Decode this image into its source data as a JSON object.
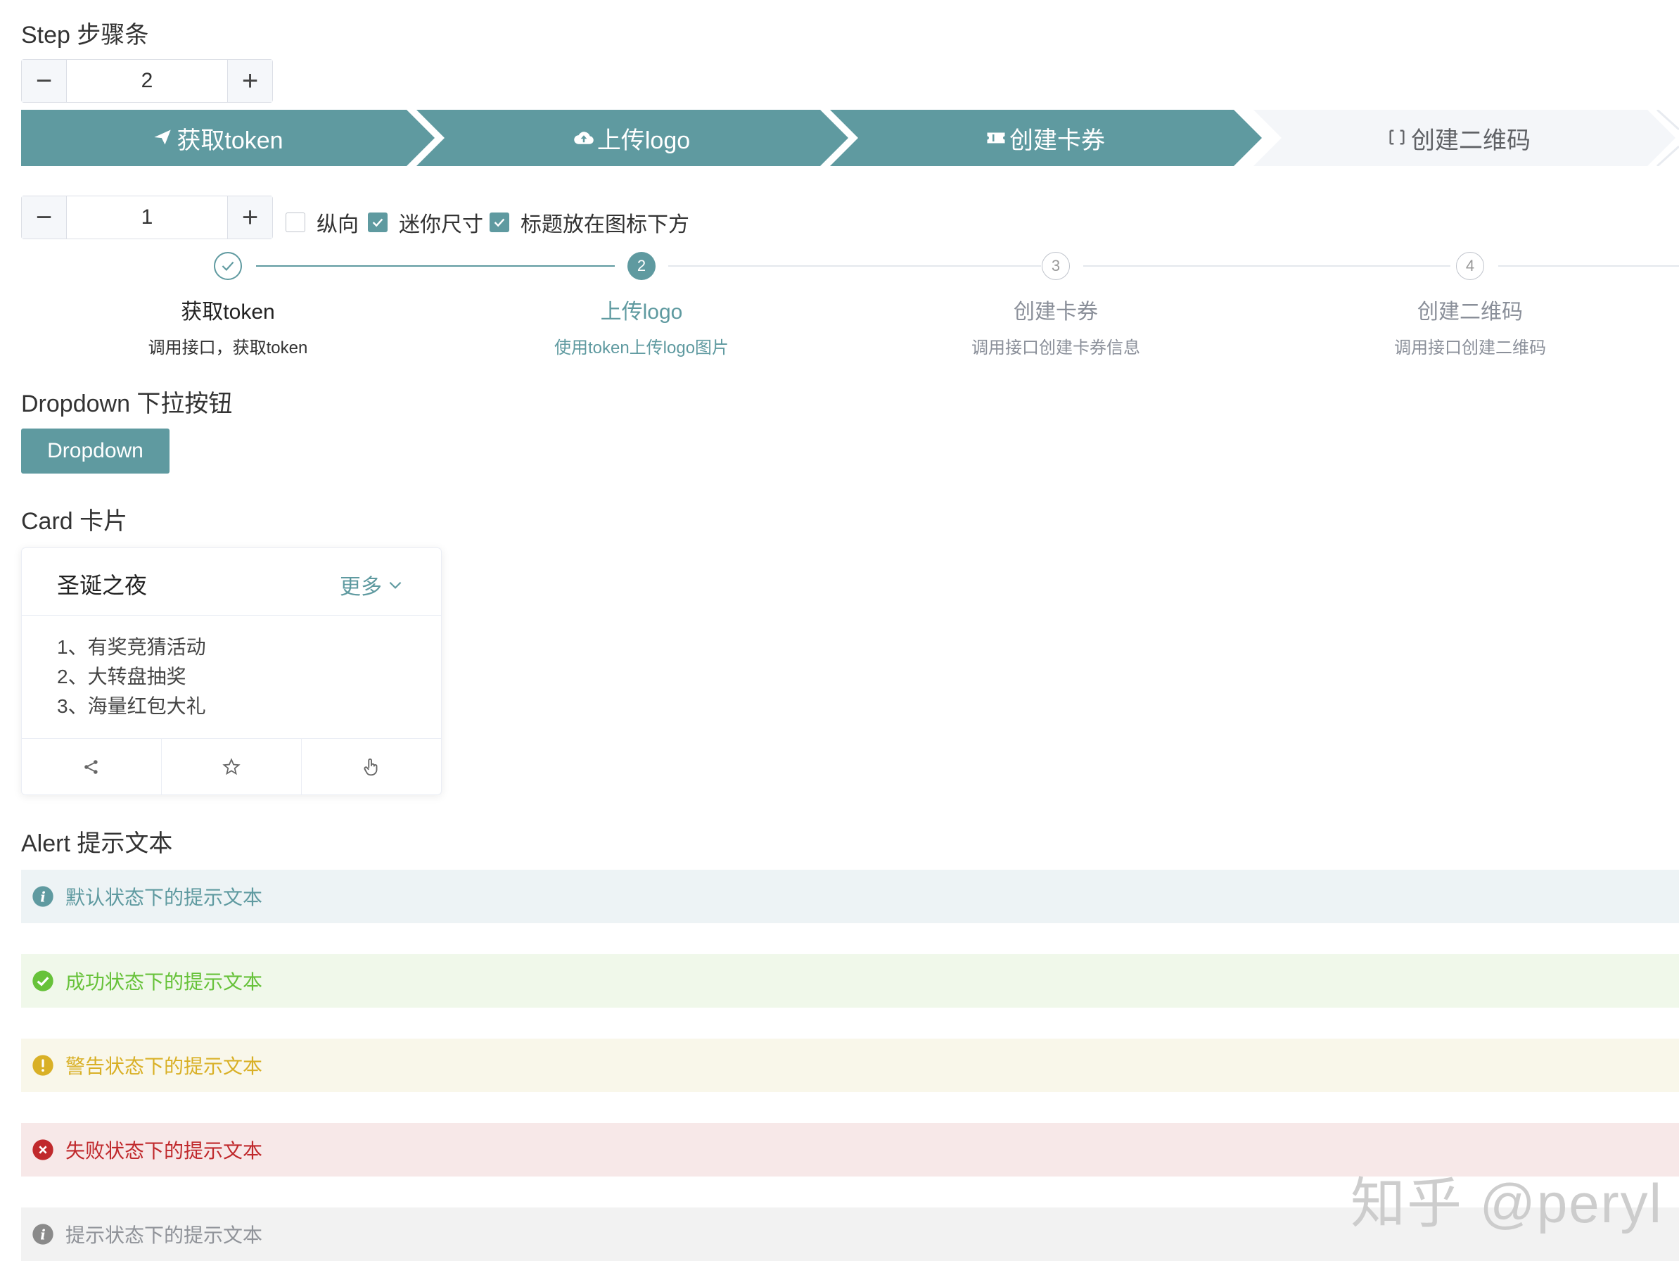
{
  "colors": {
    "primary": "#5f9aa0",
    "inactive_step_bg": "#f4f6f9",
    "success": "#67c23a",
    "warning": "#d9b026",
    "danger": "#c0292c",
    "info": "#909399"
  },
  "step_section": {
    "title": "Step 步骤条",
    "stepper1": {
      "minus": "−",
      "value": "2",
      "plus": "+"
    },
    "arrow_steps": [
      {
        "label": "获取token",
        "icon": "send-icon",
        "active": true
      },
      {
        "label": "上传logo",
        "icon": "cloud-upload-icon",
        "active": true
      },
      {
        "label": "创建卡券",
        "icon": "ticket-icon",
        "active": true
      },
      {
        "label": "创建二维码",
        "icon": "scan-icon",
        "active": false
      }
    ],
    "stepper2": {
      "minus": "−",
      "value": "1",
      "plus": "+"
    },
    "checkboxes": [
      {
        "label": "纵向",
        "checked": false
      },
      {
        "label": "迷你尺寸",
        "checked": true
      },
      {
        "label": "标题放在图标下方",
        "checked": true
      }
    ],
    "dot_steps": [
      {
        "number": "",
        "title": "获取token",
        "desc": "调用接口，获取token",
        "status": "finish"
      },
      {
        "number": "2",
        "title": "上传logo",
        "desc": "使用token上传logo图片",
        "status": "process"
      },
      {
        "number": "3",
        "title": "创建卡券",
        "desc": "调用接口创建卡券信息",
        "status": "wait"
      },
      {
        "number": "4",
        "title": "创建二维码",
        "desc": "调用接口创建二维码",
        "status": "wait"
      }
    ]
  },
  "dropdown_section": {
    "title": "Dropdown 下拉按钮",
    "button_label": "Dropdown"
  },
  "card_section": {
    "title": "Card 卡片",
    "card_title": "圣诞之夜",
    "more_label": "更多",
    "items": [
      "1、有奖竞猜活动",
      "2、大转盘抽奖",
      "3、海量红包大礼"
    ],
    "actions": [
      "share-icon",
      "star-icon",
      "pointer-icon"
    ]
  },
  "alert_section": {
    "title": "Alert 提示文本",
    "alerts": [
      {
        "type": "default",
        "text": "默认状态下的提示文本",
        "icon": "info-icon"
      },
      {
        "type": "success",
        "text": "成功状态下的提示文本",
        "icon": "check-circle-icon"
      },
      {
        "type": "warning",
        "text": "警告状态下的提示文本",
        "icon": "warning-icon"
      },
      {
        "type": "danger",
        "text": "失败状态下的提示文本",
        "icon": "close-circle-icon"
      },
      {
        "type": "info",
        "text": "提示状态下的提示文本",
        "icon": "info-icon"
      }
    ]
  },
  "watermark": "知乎 @peryl"
}
